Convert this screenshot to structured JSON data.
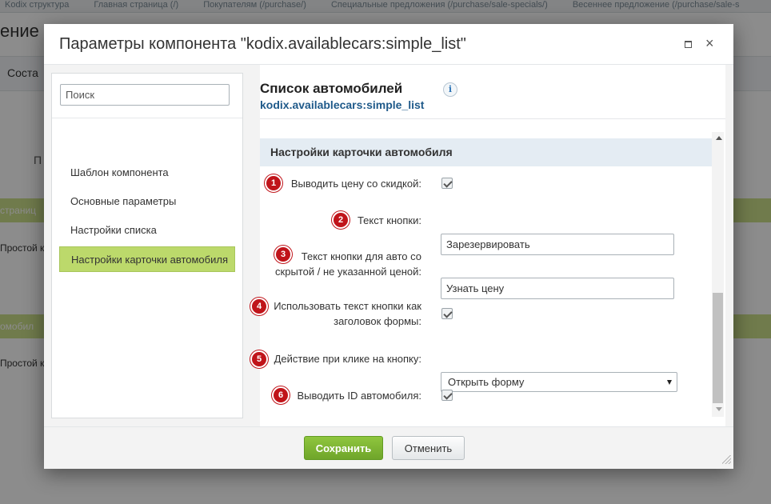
{
  "background": {
    "breadcrumbs": [
      "Kodix структура",
      "Главная страница (/)",
      "Покупателям (/purchase/)",
      "Специальные предложения (/purchase/sale-specials/)",
      "Весеннее предложение (/purchase/sale-s"
    ],
    "page_title": "ение у",
    "nav_tab": "Соста",
    "side_char": "П",
    "bar1_text": "страниц",
    "line1_text": "Простой к",
    "bar2_text": "омобил",
    "line2_text": "Простой к"
  },
  "dialog": {
    "title": "Параметры компонента \"kodix.availablecars:simple_list\"",
    "maximize_icon": "maximize-icon",
    "close_label": "×"
  },
  "left_panel": {
    "search_placeholder": "Поиск",
    "items": [
      {
        "label": "Шаблон компонента"
      },
      {
        "label": "Основные параметры"
      },
      {
        "label": "Настройки списка"
      },
      {
        "label": "Настройки карточки автомобиля",
        "active": true
      }
    ]
  },
  "right_panel": {
    "title": "Список автомобилей",
    "subtitle": "kodix.availablecars:simple_list",
    "info_label": "i",
    "section_title": "Настройки карточки автомобиля",
    "rows": [
      {
        "badge": "1",
        "label": "Выводить цену со скидкой:",
        "type": "checkbox",
        "checked": true
      },
      {
        "badge": "2",
        "label": "Текст кнопки:",
        "type": "text",
        "value": "Зарезервировать"
      },
      {
        "badge": "3",
        "label_line1": "Текст кнопки для авто со",
        "label_line2": "скрытой / не указанной ценой:",
        "type": "text",
        "value": "Узнать цену"
      },
      {
        "badge": "4",
        "label_line1": "Использовать текст кнопки как",
        "label_line2": "заголовок формы:",
        "type": "checkbox",
        "checked": true
      },
      {
        "badge": "5",
        "label": "Действие при клике на кнопку:",
        "type": "select",
        "value": "Открыть форму"
      },
      {
        "badge": "6",
        "label": "Выводить ID автомобиля:",
        "type": "checkbox",
        "checked": true
      }
    ]
  },
  "footer": {
    "save_label": "Сохранить",
    "cancel_label": "Отменить"
  },
  "colors": {
    "active_item": "#bcd96b",
    "save_button": "#7ab332",
    "badge": "#c0141a",
    "link": "#1f5a8a"
  }
}
